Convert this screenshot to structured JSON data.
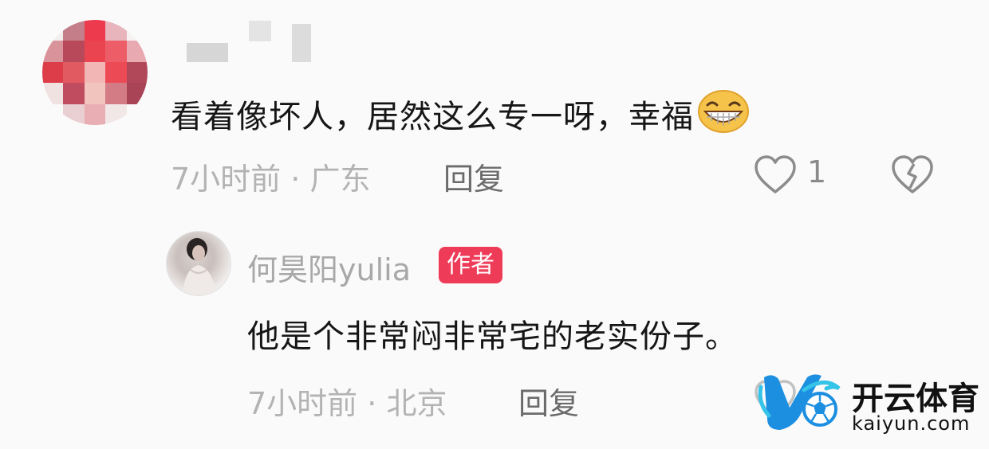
{
  "comment": {
    "text": "看着像坏人，居然这么专一呀，幸福",
    "emoji": "grin-emoji",
    "time": "7小时前",
    "separator": "·",
    "location": "广东",
    "reply_label": "回复",
    "like_count": "1"
  },
  "reply": {
    "author": "何昊阳yulia",
    "badge": "作者",
    "text": "他是个非常闷非常宅的老实份子。",
    "time": "7小时前",
    "separator": "·",
    "location": "北京",
    "reply_label": "回复"
  },
  "watermark": {
    "title": "开云体育",
    "subtitle": "kaiyun.com"
  },
  "colors": {
    "badge": "#ee3b58",
    "logo_blue": "#1d8fe0",
    "logo_cyan": "#35c3e8"
  }
}
